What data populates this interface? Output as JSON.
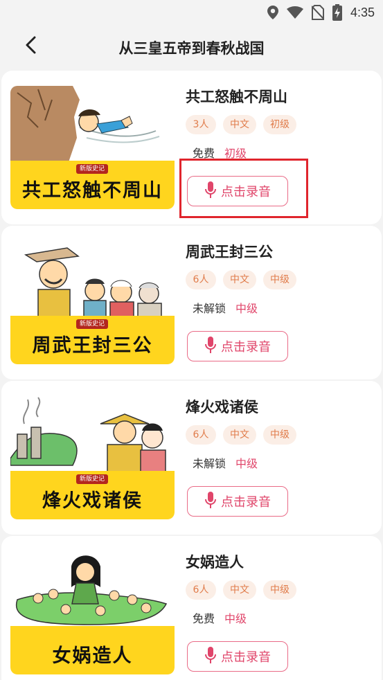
{
  "status_bar": {
    "time": "4:35",
    "icons": [
      "location-icon",
      "wifi-icon",
      "no-sim-icon",
      "battery-charging-icon"
    ]
  },
  "nav": {
    "back_icon": "chevron-left-icon",
    "title": "从三皇五帝到春秋战国"
  },
  "colors": {
    "accent": "#e0456a",
    "tag_bg": "#fbeee6",
    "tag_text": "#e07c4b",
    "banner": "#ffd51e",
    "highlight": "#e0252d"
  },
  "lessons": [
    {
      "title": "共工怒触不周山",
      "banner_title": "共工怒触不周山",
      "badge": "新版史记",
      "tags": [
        "3人",
        "中文",
        "初级"
      ],
      "access": "免费",
      "level": "初级",
      "record_label": "点击录音"
    },
    {
      "title": "周武王封三公",
      "banner_title": "周武王封三公",
      "badge": "新版史记",
      "tags": [
        "6人",
        "中文",
        "中级"
      ],
      "access": "未解锁",
      "level": "中级",
      "record_label": "点击录音"
    },
    {
      "title": "烽火戏诸侯",
      "banner_title": "烽火戏诸侯",
      "badge": "新版史记",
      "tags": [
        "6人",
        "中文",
        "中级"
      ],
      "access": "未解锁",
      "level": "中级",
      "record_label": "点击录音"
    },
    {
      "title": "女娲造人",
      "banner_title": "女娲造人",
      "badge": "",
      "tags": [
        "6人",
        "中文",
        "中级"
      ],
      "access": "免费",
      "level": "中级",
      "record_label": "点击录音"
    }
  ]
}
